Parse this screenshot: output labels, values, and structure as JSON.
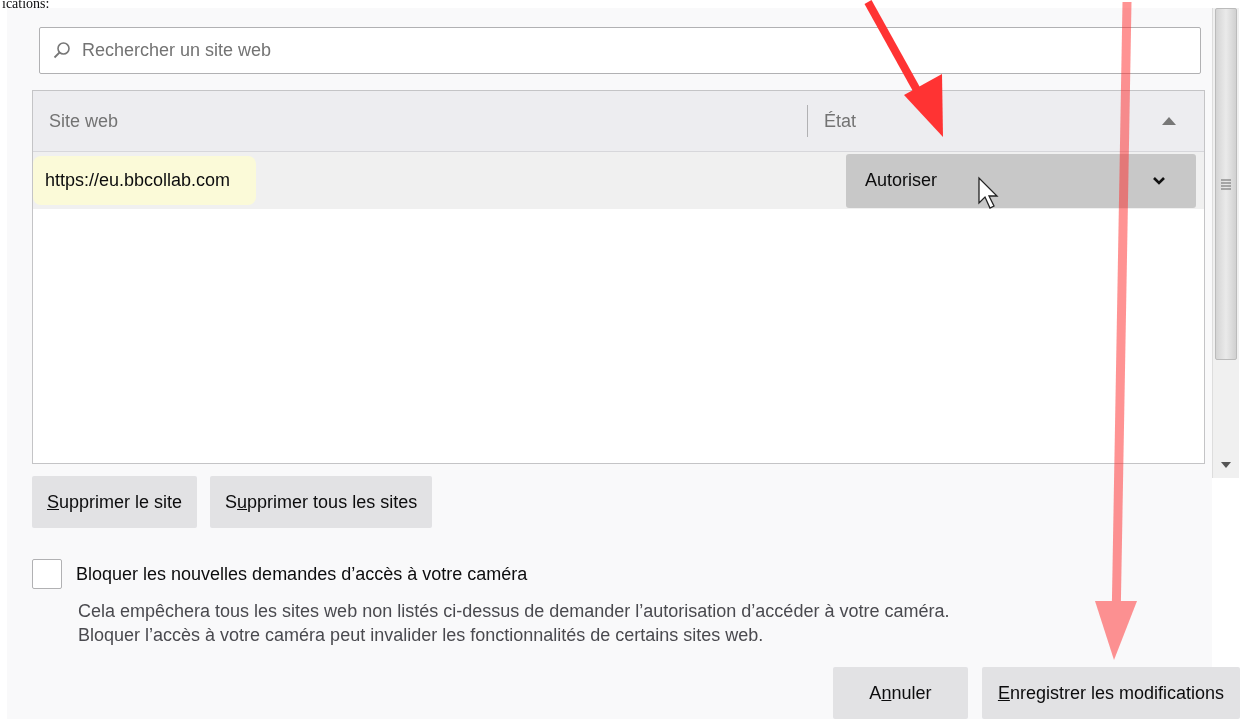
{
  "caption_fragment": "ications:",
  "search": {
    "placeholder": "Rechercher un site web"
  },
  "table": {
    "columns": [
      {
        "label": "Site web",
        "sorted": false
      },
      {
        "label": "État",
        "sorted": true
      }
    ],
    "rows": [
      {
        "site": "https://eu.bbcollab.com",
        "highlighted": true,
        "selected": true,
        "status": "Autoriser"
      }
    ]
  },
  "site_buttons": [
    {
      "accesskey": "S",
      "after": "upprimer le site"
    },
    {
      "before": "S",
      "accesskey": "u",
      "after": "pprimer tous les sites"
    }
  ],
  "block_option": {
    "label": "Bloquer les nouvelles demandes d’accès à votre caméra",
    "checked": false,
    "description": "Cela empêchera tous les sites web non listés ci-dessus de demander l’autorisation d’accéder à votre caméra. Bloquer l’accès à votre caméra peut invalider les fonctionnalités de certains sites web."
  },
  "footer_buttons": [
    {
      "before": "A",
      "accesskey": "n",
      "after": "nuler"
    },
    {
      "accesskey": "E",
      "after": "nregistrer les modifications"
    }
  ]
}
